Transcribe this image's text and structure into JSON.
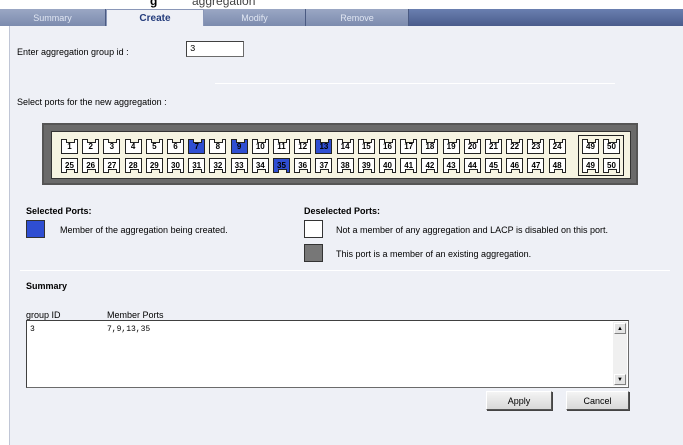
{
  "title": {
    "bold_fragment": "g",
    "rest_fragment": "aggregation"
  },
  "tabs": [
    {
      "label": "Summary",
      "active": false
    },
    {
      "label": "Create",
      "active": true
    },
    {
      "label": "Modify",
      "active": false
    },
    {
      "label": "Remove",
      "active": false
    }
  ],
  "form": {
    "group_id_label": "Enter aggregation group id :",
    "group_id_value": "3",
    "select_ports_label": "Select ports for the new aggregation :"
  },
  "ports": {
    "top_row": [
      "1",
      "2",
      "3",
      "4",
      "5",
      "6",
      "7",
      "8",
      "9",
      "10",
      "11",
      "12",
      "13",
      "14",
      "15",
      "16",
      "17",
      "18",
      "19",
      "20",
      "21",
      "22",
      "23",
      "24"
    ],
    "bottom_row": [
      "25",
      "26",
      "27",
      "28",
      "29",
      "30",
      "31",
      "32",
      "33",
      "34",
      "35",
      "36",
      "37",
      "38",
      "39",
      "40",
      "41",
      "42",
      "43",
      "44",
      "45",
      "46",
      "47",
      "48"
    ],
    "sfp_top": [
      "49",
      "50"
    ],
    "sfp_bottom": [
      "49",
      "50"
    ],
    "selected": [
      "7",
      "9",
      "13",
      "35"
    ],
    "colors": {
      "selected": "#2f4ed2",
      "deselected": "#ffffff",
      "in_other_aggregation": "#777777"
    }
  },
  "legend": {
    "selected_heading": "Selected Ports:",
    "selected_text": "Member of the aggregation being created.",
    "deselected_heading": "Deselected Ports:",
    "deselected_text": "Not a member of any aggregation and LACP is disabled on this port.",
    "other_text": "This port is a member of an existing aggregation."
  },
  "summary": {
    "heading": "Summary",
    "col_group_id": "group ID",
    "col_member_ports": "Member Ports",
    "rows": [
      {
        "group_id": "3",
        "member_ports": "7,9,13,35"
      }
    ]
  },
  "buttons": {
    "apply": "Apply",
    "cancel": "Cancel"
  }
}
